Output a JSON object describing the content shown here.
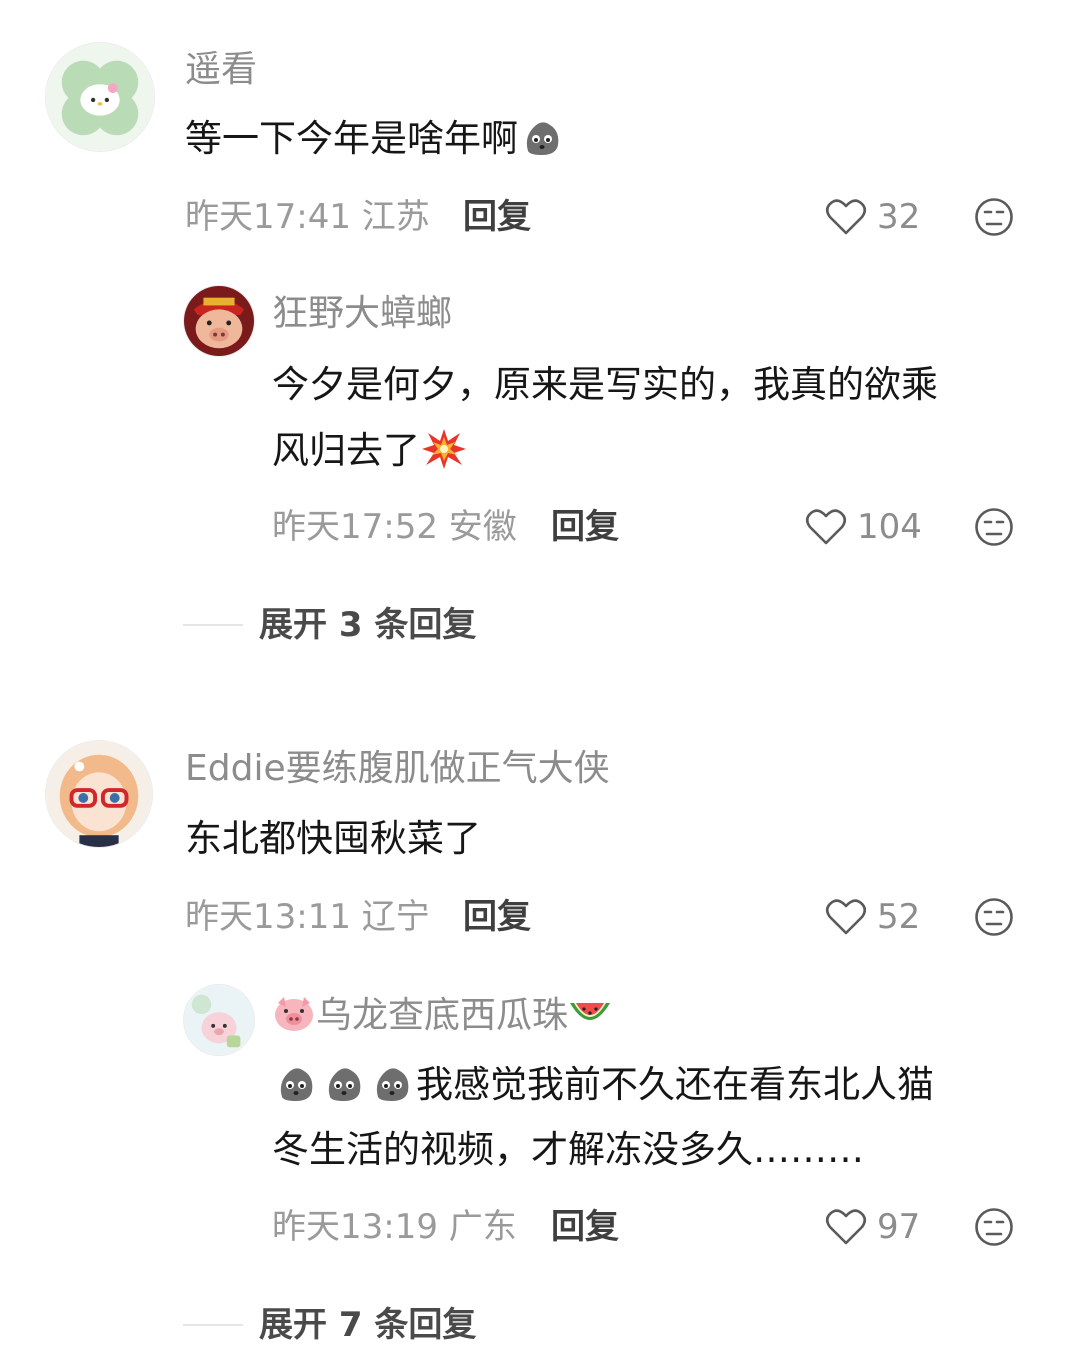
{
  "comments": [
    {
      "user": "遥看",
      "text_before": "等一下今年是啥年啊",
      "emoji_after": "sad-rock-emoji",
      "meta": "昨天17:41 江苏",
      "reply_label": "回复",
      "likes": "32",
      "reply": {
        "user": "狂野大蟑螂",
        "line1": "今夕是何夕，原来是写实的，我真的欲乘",
        "line2": "风归去了",
        "emoji_after": "explosion-emoji",
        "meta": "昨天17:52 安徽",
        "reply_label": "回复",
        "likes": "104"
      },
      "expand_label": "展开 3 条回复"
    },
    {
      "user": "Eddie要练腹肌做正气大侠",
      "text": "东北都快囤秋菜了",
      "meta": "昨天13:11 辽宁",
      "reply_label": "回复",
      "likes": "52",
      "reply": {
        "user_prefix_icon": "pig-face-emoji",
        "user": "乌龙查底西瓜珠",
        "user_suffix_icon": "watermelon-emoji",
        "line1_emojis": [
          "sad-rock-emoji",
          "sad-rock-emoji",
          "sad-rock-emoji"
        ],
        "line1": "我感觉我前不久还在看东北人猫",
        "line2": "冬生活的视频，才解冻没多久………",
        "meta": "昨天13:19 广东",
        "reply_label": "回复",
        "likes": "97"
      },
      "expand_label": "展开 7 条回复"
    }
  ],
  "colors": {
    "username": "#8c8c8c",
    "body_text": "#161616",
    "meta_text": "#9a9a9a",
    "reply_button": "#3f3f3f"
  }
}
